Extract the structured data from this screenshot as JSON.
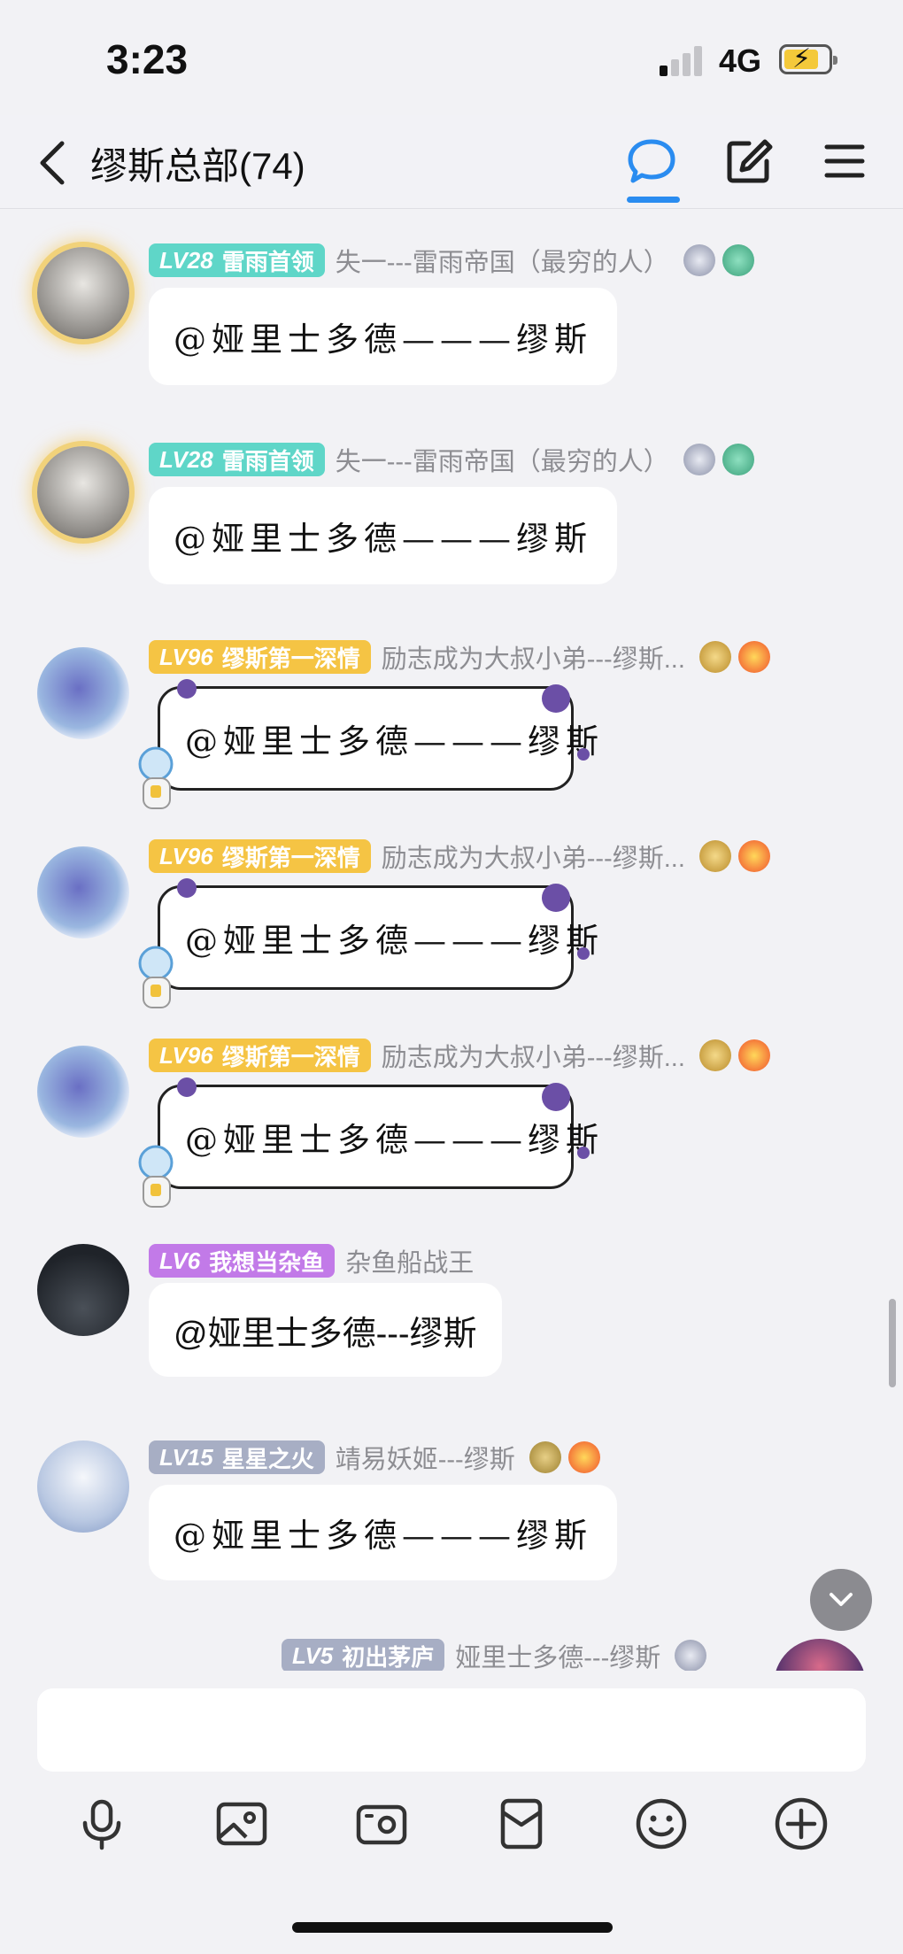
{
  "status_bar": {
    "time": "3:23",
    "network": "4G"
  },
  "header": {
    "title": "缪斯总部(74)"
  },
  "messages": [
    {
      "level": "LV28",
      "title": "雷雨首领",
      "level_color": "#5fd6c8",
      "nickname": "失一---雷雨帝国（最穷的人）",
      "text": "@娅里士多德———缪斯"
    },
    {
      "level": "LV28",
      "title": "雷雨首领",
      "level_color": "#5fd6c8",
      "nickname": "失一---雷雨帝国（最穷的人）",
      "text": "@娅里士多德———缪斯"
    },
    {
      "level": "LV96",
      "title": "缪斯第一深情",
      "level_color": "#f5c444",
      "nickname": "励志成为大叔小弟---缪斯...",
      "text": "@娅里士多德———缪斯"
    },
    {
      "level": "LV96",
      "title": "缪斯第一深情",
      "level_color": "#f5c444",
      "nickname": "励志成为大叔小弟---缪斯...",
      "text": "@娅里士多德———缪斯"
    },
    {
      "level": "LV96",
      "title": "缪斯第一深情",
      "level_color": "#f5c444",
      "nickname": "励志成为大叔小弟---缪斯...",
      "text": "@娅里士多德———缪斯"
    },
    {
      "level": "LV6",
      "title": "我想当杂鱼",
      "level_color": "#c27ae8",
      "nickname": "杂鱼船战王",
      "text": "@娅里士多德---缪斯"
    },
    {
      "level": "LV15",
      "title": "星星之火",
      "level_color": "#a7aec4",
      "nickname": "靖易妖姬---缪斯",
      "text": "@娅里士多德———缪斯"
    },
    {
      "level": "LV5",
      "title": "初出茅庐",
      "level_color": "#a7aec4",
      "nickname": "娅里士多德---缪斯",
      "text": ""
    }
  ]
}
